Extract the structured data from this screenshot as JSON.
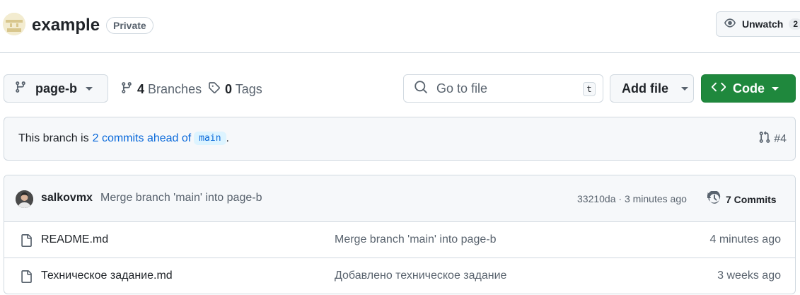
{
  "repo": {
    "name": "example",
    "visibility": "Private",
    "unwatch_label": "Unwatch",
    "unwatch_count": "2"
  },
  "toolbar": {
    "branch": "page-b",
    "branches_count": "4",
    "branches_label": "Branches",
    "tags_count": "0",
    "tags_label": "Tags",
    "goto_placeholder": "Go to file",
    "goto_shortcut": "t",
    "add_file_label": "Add file",
    "code_label": "Code"
  },
  "ahead": {
    "prefix": "This branch is",
    "link": "2 commits ahead of",
    "base_branch": "main",
    "suffix": ".",
    "pr": "#4"
  },
  "latest_commit": {
    "author": "salkovmx",
    "message": "Merge branch 'main' into page-b",
    "meta": "33210da · 3 minutes ago",
    "commits_label": "7 Commits"
  },
  "files": [
    {
      "name": "README.md",
      "commit": "Merge branch 'main' into page-b",
      "time": "4 minutes ago"
    },
    {
      "name": "Техническое задание.md",
      "commit": "Добавлено техническое задание",
      "time": "3 weeks ago"
    }
  ],
  "colors": {
    "accent_green": "#1f883d",
    "link_blue": "#0969da",
    "muted": "#59636e"
  }
}
